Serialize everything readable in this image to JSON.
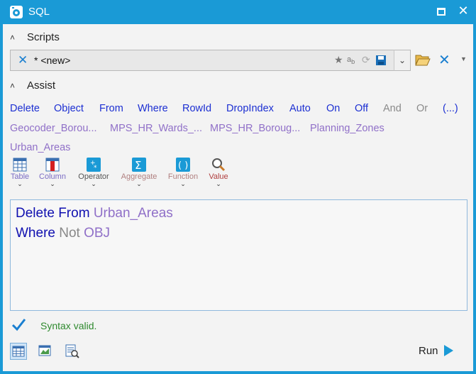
{
  "window": {
    "title": "SQL"
  },
  "scripts_section": {
    "label": "Scripts"
  },
  "script_bar": {
    "name": "* <new>"
  },
  "assist_section": {
    "label": "Assist"
  },
  "keywords": [
    "Delete",
    "Object",
    "From",
    "Where",
    "RowId",
    "DropIndex",
    "Auto",
    "On",
    "Off",
    "And",
    "Or",
    "(...)"
  ],
  "tables": [
    "Geocoder_Borou...",
    "MPS_HR_Wards_...",
    "MPS_HR_Boroug...",
    "Planning_Zones",
    "Urban_Areas"
  ],
  "assist_buttons": [
    {
      "label": "Table",
      "icon": "table-icon",
      "color": "#7b6cc4"
    },
    {
      "label": "Column",
      "icon": "column-icon",
      "color": "#7b6cc4"
    },
    {
      "label": "Operator",
      "icon": "operator-icon",
      "color": "#555555"
    },
    {
      "label": "Aggregate",
      "icon": "sigma-icon",
      "color": "#b08080"
    },
    {
      "label": "Function",
      "icon": "parentheses-icon",
      "color": "#b08080"
    },
    {
      "label": "Value",
      "icon": "magnifier-icon",
      "color": "#b04040"
    }
  ],
  "editor": {
    "line1": {
      "kw1": "Delete",
      "kw2": "From",
      "ident": "Urban_Areas"
    },
    "line2": {
      "kw1": "Where",
      "kw2": "Not",
      "ident": "OBJ"
    }
  },
  "status": {
    "text": "Syntax valid."
  },
  "run": {
    "label": "Run"
  },
  "colors": {
    "accent": "#1a9ad6",
    "keyword": "#1c2fd2",
    "identifier": "#9070c8",
    "muted": "#8a8a8a",
    "valid": "#2f8a2f"
  }
}
